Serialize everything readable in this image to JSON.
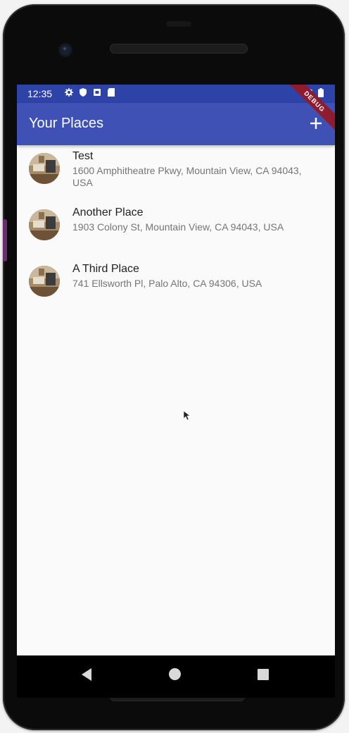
{
  "status_bar": {
    "time": "12:35",
    "left_icons": [
      "gear-icon",
      "shield-icon",
      "sim-icon",
      "sd-card-icon"
    ],
    "right_icons": [
      "wifi-icon",
      "battery-icon"
    ]
  },
  "app_bar": {
    "title": "Your Places",
    "add_icon": "plus-icon",
    "color": "#3f51b5"
  },
  "debug_banner": "DEBUG",
  "places": [
    {
      "title": "Test",
      "address": "1600 Amphitheatre Pkwy, Mountain View, CA 94043, USA"
    },
    {
      "title": "Another Place",
      "address": "1903 Colony St, Mountain View, CA 94043, USA"
    },
    {
      "title": "A Third Place",
      "address": "741 Ellsworth Pl, Palo Alto, CA 94306, USA"
    }
  ],
  "nav_bar": {
    "buttons": [
      "back-icon",
      "home-icon",
      "recents-icon"
    ]
  }
}
